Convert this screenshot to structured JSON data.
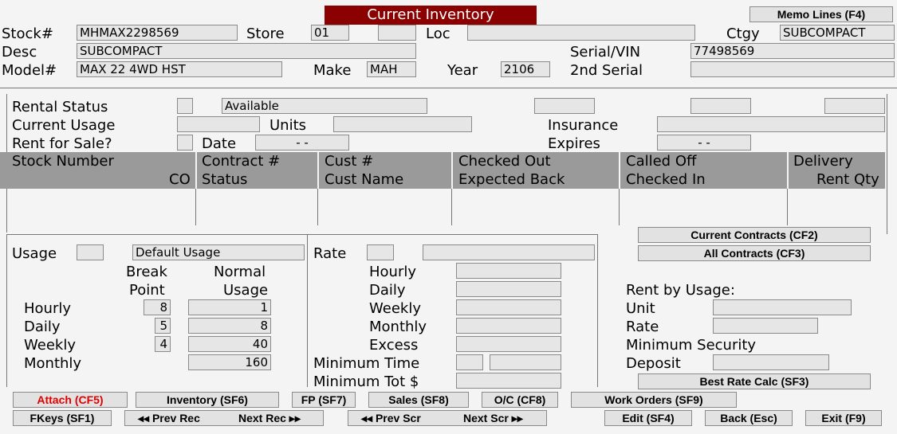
{
  "window": {
    "title": "Current Inventory",
    "memo_button": "Memo Lines (F4)"
  },
  "header": {
    "stock_label": "Stock#",
    "stock_value": "MHMAX2298569",
    "store_label": "Store",
    "store_value": "01",
    "store_extra": "",
    "loc_label": "Loc",
    "loc_value": "",
    "ctgy_label": "Ctgy",
    "ctgy_value": "SUBCOMPACT",
    "desc_label": "Desc",
    "desc_value": "SUBCOMPACT",
    "serial_label": "Serial/VIN",
    "serial_value": "77498569",
    "model_label": "Model#",
    "model_value": "MAX 22 4WD HST",
    "make_label": "Make",
    "make_value": "MAH",
    "year_label": "Year",
    "year_value": "2106",
    "serial2_label": "2nd Serial",
    "serial2_value": ""
  },
  "rental": {
    "status_label": "Rental Status",
    "status_code": "",
    "status_value": "Available",
    "usage_label": "Current Usage",
    "usage_value": "",
    "units_label": "Units",
    "units_value": "",
    "rent_for_sale_label": "Rent for Sale?",
    "rent_for_sale_value": "",
    "date_label": "Date",
    "date_value": "-  -",
    "insurance_label": "Insurance",
    "insurance_value": "",
    "expires_label": "Expires",
    "expires_value": "-  -"
  },
  "contracts_table": {
    "headers": [
      {
        "line1": "Stock Number",
        "line2": "CO"
      },
      {
        "line1": "Contract #",
        "line2": "Status"
      },
      {
        "line1": "Cust #",
        "line2": "Cust Name"
      },
      {
        "line1": "Checked Out",
        "line2": "Expected Back"
      },
      {
        "line1": "Called Off",
        "line2": "Checked In"
      },
      {
        "line1": "Delivery",
        "line2": "Rent Qty"
      }
    ]
  },
  "usage_section": {
    "usage_label": "Usage",
    "usage_code": "",
    "usage_value": "Default Usage",
    "col1_line1": "Break",
    "col1_line2": "Point",
    "col2_line1": "Normal",
    "col2_line2": "Usage",
    "rows": [
      {
        "label": "Hourly",
        "break": "8",
        "normal": "1"
      },
      {
        "label": "Daily",
        "break": "5",
        "normal": "8"
      },
      {
        "label": "Weekly",
        "break": "4",
        "normal": "40"
      },
      {
        "label": "Monthly",
        "normal": "160"
      }
    ]
  },
  "rate_section": {
    "rate_label": "Rate",
    "rate_code": "",
    "rate_value": "",
    "rows": [
      "Hourly",
      "Daily",
      "Weekly",
      "Monthly",
      "Excess"
    ],
    "min_time_label": "Minimum Time",
    "min_tot_label": "Minimum Tot $"
  },
  "right_panel": {
    "current_contracts_button": "Current Contracts (CF2)",
    "all_contracts_button": "All Contracts (CF3)",
    "rent_by_usage_label": "Rent by Usage:",
    "unit_label": "Unit",
    "rate_label": "Rate",
    "min_security_label": "Minimum Security",
    "deposit_label": "Deposit",
    "best_rate_button": "Best Rate Calc (SF3)"
  },
  "toolbar": {
    "attach": "Attach (CF5)",
    "inventory": "Inventory (SF6)",
    "fp": "FP (SF7)",
    "sales": "Sales (SF8)",
    "oc": "O/C (CF8)",
    "work_orders": "Work Orders (SF9)",
    "fkeys": "FKeys (SF1)",
    "prev_rec": "◂◂ Prev Rec",
    "next_rec": "Next Rec ▸▸",
    "prev_scr": "◂◂ Prev Scr",
    "next_scr": "Next Scr ▸▸",
    "edit": "Edit (SF4)",
    "back": "Back (Esc)",
    "exit": "Exit (F9)"
  },
  "colors": {
    "title_bg": "#8b0000",
    "grid_header": "#9a9a9a",
    "attach_text": "#e00000"
  }
}
